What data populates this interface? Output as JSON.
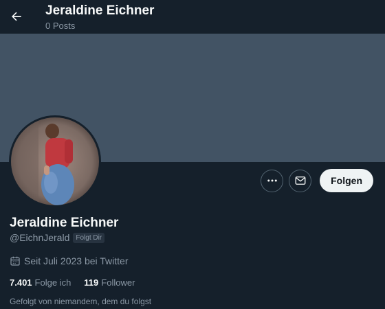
{
  "header": {
    "back_icon": "arrow-left-icon",
    "name": "Jeraldine Eichner",
    "posts": "0 Posts"
  },
  "profile": {
    "name": "Jeraldine Eichner",
    "handle": "@EichnJerald",
    "follows_you": "Folgt Dir",
    "joined": "Seit Juli 2023 bei Twitter",
    "following_count": "7.401",
    "following_label": "Folge ich",
    "followers_count": "119",
    "followers_label": "Follower",
    "followed_by": "Gefolgt von niemandem, dem du folgst"
  },
  "actions": {
    "more_icon": "more-icon",
    "message_icon": "mail-icon",
    "follow_label": "Folgen"
  },
  "colors": {
    "background": "#15202b",
    "banner": "#425364",
    "muted_text": "#8b98a5",
    "follow_button_bg": "#eff3f4"
  }
}
